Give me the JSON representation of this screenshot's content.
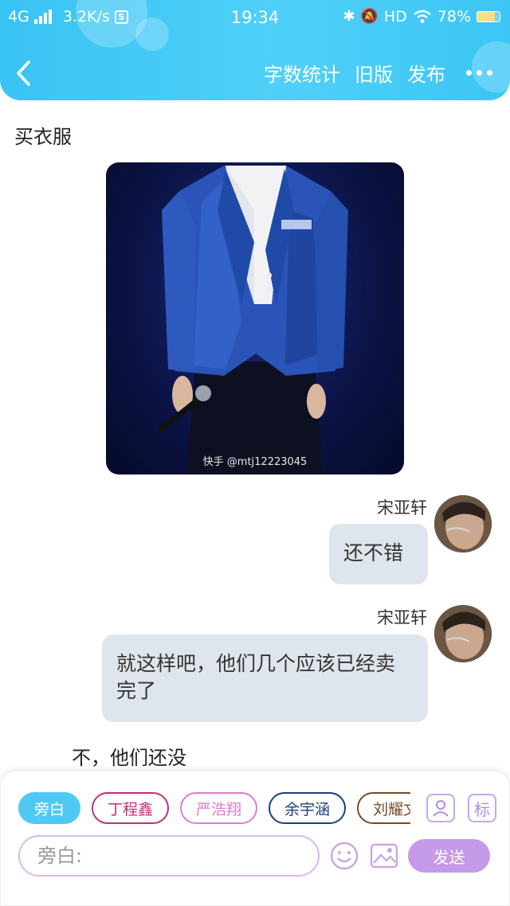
{
  "status_bar": {
    "network": "4G",
    "speed": "3.2K/s",
    "time": "19:34",
    "hd": "HD",
    "battery": "78%"
  },
  "nav": {
    "word_count": "字数统计",
    "old_version": "旧版",
    "publish": "发布"
  },
  "chat": {
    "narration_1": "买衣服",
    "image_watermark": "快手 @mtj12223045",
    "messages": [
      {
        "sender": "宋亚轩",
        "text": "还不错"
      },
      {
        "sender": "宋亚轩",
        "text": "就这样吧，他们几个应该已经卖完了"
      }
    ],
    "narration_2": "不，他们还没"
  },
  "input_panel": {
    "roles": [
      {
        "label": "旁白",
        "color": "#4fc9f3",
        "selected": true
      },
      {
        "label": "丁程鑫",
        "color": "#c0307a",
        "selected": false
      },
      {
        "label": "严浩翔",
        "color": "#e07bd0",
        "selected": false
      },
      {
        "label": "余宇涵",
        "color": "#1a3f7a",
        "selected": false
      },
      {
        "label": "刘耀文",
        "color": "#7a4a2a",
        "selected": false
      }
    ],
    "mark_label": "标",
    "placeholder": "旁白:",
    "send_label": "发送"
  }
}
